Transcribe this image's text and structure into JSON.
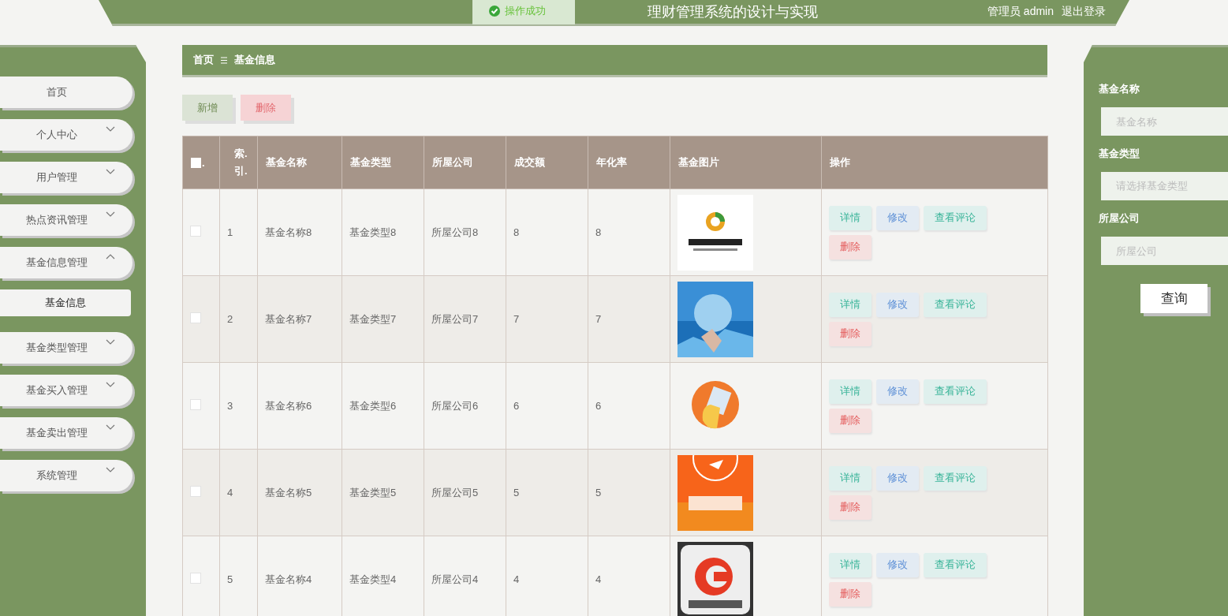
{
  "header": {
    "title": "理财管理系统的设计与实现",
    "user": "管理员 admin",
    "logout": "退出登录"
  },
  "toast": {
    "text": "操作成功"
  },
  "sidebar": {
    "items": [
      {
        "label": "首页",
        "kind": "link"
      },
      {
        "label": "个人中心",
        "kind": "menu",
        "expanded": false
      },
      {
        "label": "用户管理",
        "kind": "menu",
        "expanded": false
      },
      {
        "label": "热点资讯管理",
        "kind": "menu",
        "expanded": false
      },
      {
        "label": "基金信息管理",
        "kind": "menu",
        "expanded": true,
        "children": [
          {
            "label": "基金信息",
            "selected": true
          }
        ]
      },
      {
        "label": "基金类型管理",
        "kind": "menu",
        "expanded": false
      },
      {
        "label": "基金买入管理",
        "kind": "menu",
        "expanded": false
      },
      {
        "label": "基金卖出管理",
        "kind": "menu",
        "expanded": false
      },
      {
        "label": "系统管理",
        "kind": "menu",
        "expanded": false
      }
    ]
  },
  "breadcrumb": [
    "首页",
    "基金信息"
  ],
  "toolbar": [
    {
      "label": "新增",
      "kind": "add"
    },
    {
      "label": "删除",
      "kind": "delete"
    }
  ],
  "table": {
    "columns": [
      ".",
      "索.引.",
      "基金名称",
      "基金类型",
      "所屋公司",
      "成交额",
      "年化率",
      "基金图片",
      "操作"
    ],
    "header_checked": false,
    "rows": [
      {
        "checked": false,
        "index": "1",
        "name": "基金名称8",
        "type": "基金类型8",
        "company": "所屋公司8",
        "amount": "8",
        "rate": "8",
        "image": {
          "kind": "picture"
        },
        "actions": [
          {
            "label": "详情",
            "kind": "detail"
          },
          {
            "label": "修改",
            "kind": "edit"
          },
          {
            "label": "查看评论",
            "kind": "comments"
          },
          {
            "label": "删除",
            "kind": "delete"
          }
        ]
      },
      {
        "checked": false,
        "index": "2",
        "name": "基金名称7",
        "type": "基金类型7",
        "company": "所屋公司7",
        "amount": "7",
        "rate": "7",
        "image": {
          "kind": "picture"
        },
        "actions": [
          {
            "label": "详情",
            "kind": "detail"
          },
          {
            "label": "修改",
            "kind": "edit"
          },
          {
            "label": "查看评论",
            "kind": "comments"
          },
          {
            "label": "删除",
            "kind": "delete"
          }
        ]
      },
      {
        "checked": false,
        "index": "3",
        "name": "基金名称6",
        "type": "基金类型6",
        "company": "所屋公司6",
        "amount": "6",
        "rate": "6",
        "image": {
          "kind": "picture"
        },
        "actions": [
          {
            "label": "详情",
            "kind": "detail"
          },
          {
            "label": "修改",
            "kind": "edit"
          },
          {
            "label": "查看评论",
            "kind": "comments"
          },
          {
            "label": "删除",
            "kind": "delete"
          }
        ]
      },
      {
        "checked": false,
        "index": "4",
        "name": "基金名称5",
        "type": "基金类型5",
        "company": "所屋公司5",
        "amount": "5",
        "rate": "5",
        "image": {
          "kind": "picture"
        },
        "actions": [
          {
            "label": "详情",
            "kind": "detail"
          },
          {
            "label": "修改",
            "kind": "edit"
          },
          {
            "label": "查看评论",
            "kind": "comments"
          },
          {
            "label": "删除",
            "kind": "delete"
          }
        ]
      },
      {
        "checked": false,
        "index": "5",
        "name": "基金名称4",
        "type": "基金类型4",
        "company": "所屋公司4",
        "amount": "4",
        "rate": "4",
        "image": {
          "kind": "picture"
        },
        "actions": [
          {
            "label": "详情",
            "kind": "detail"
          },
          {
            "label": "修改",
            "kind": "edit"
          },
          {
            "label": "查看评论",
            "kind": "comments"
          },
          {
            "label": "删除",
            "kind": "delete"
          }
        ]
      }
    ]
  },
  "search": {
    "fields": [
      {
        "label": "基金名称",
        "placeholder": "基金名称",
        "kind": "input"
      },
      {
        "label": "基金类型",
        "placeholder": "请选择基金类型",
        "kind": "select"
      },
      {
        "label": "所屋公司",
        "placeholder": "所屋公司",
        "kind": "input"
      }
    ],
    "button": "查询"
  }
}
